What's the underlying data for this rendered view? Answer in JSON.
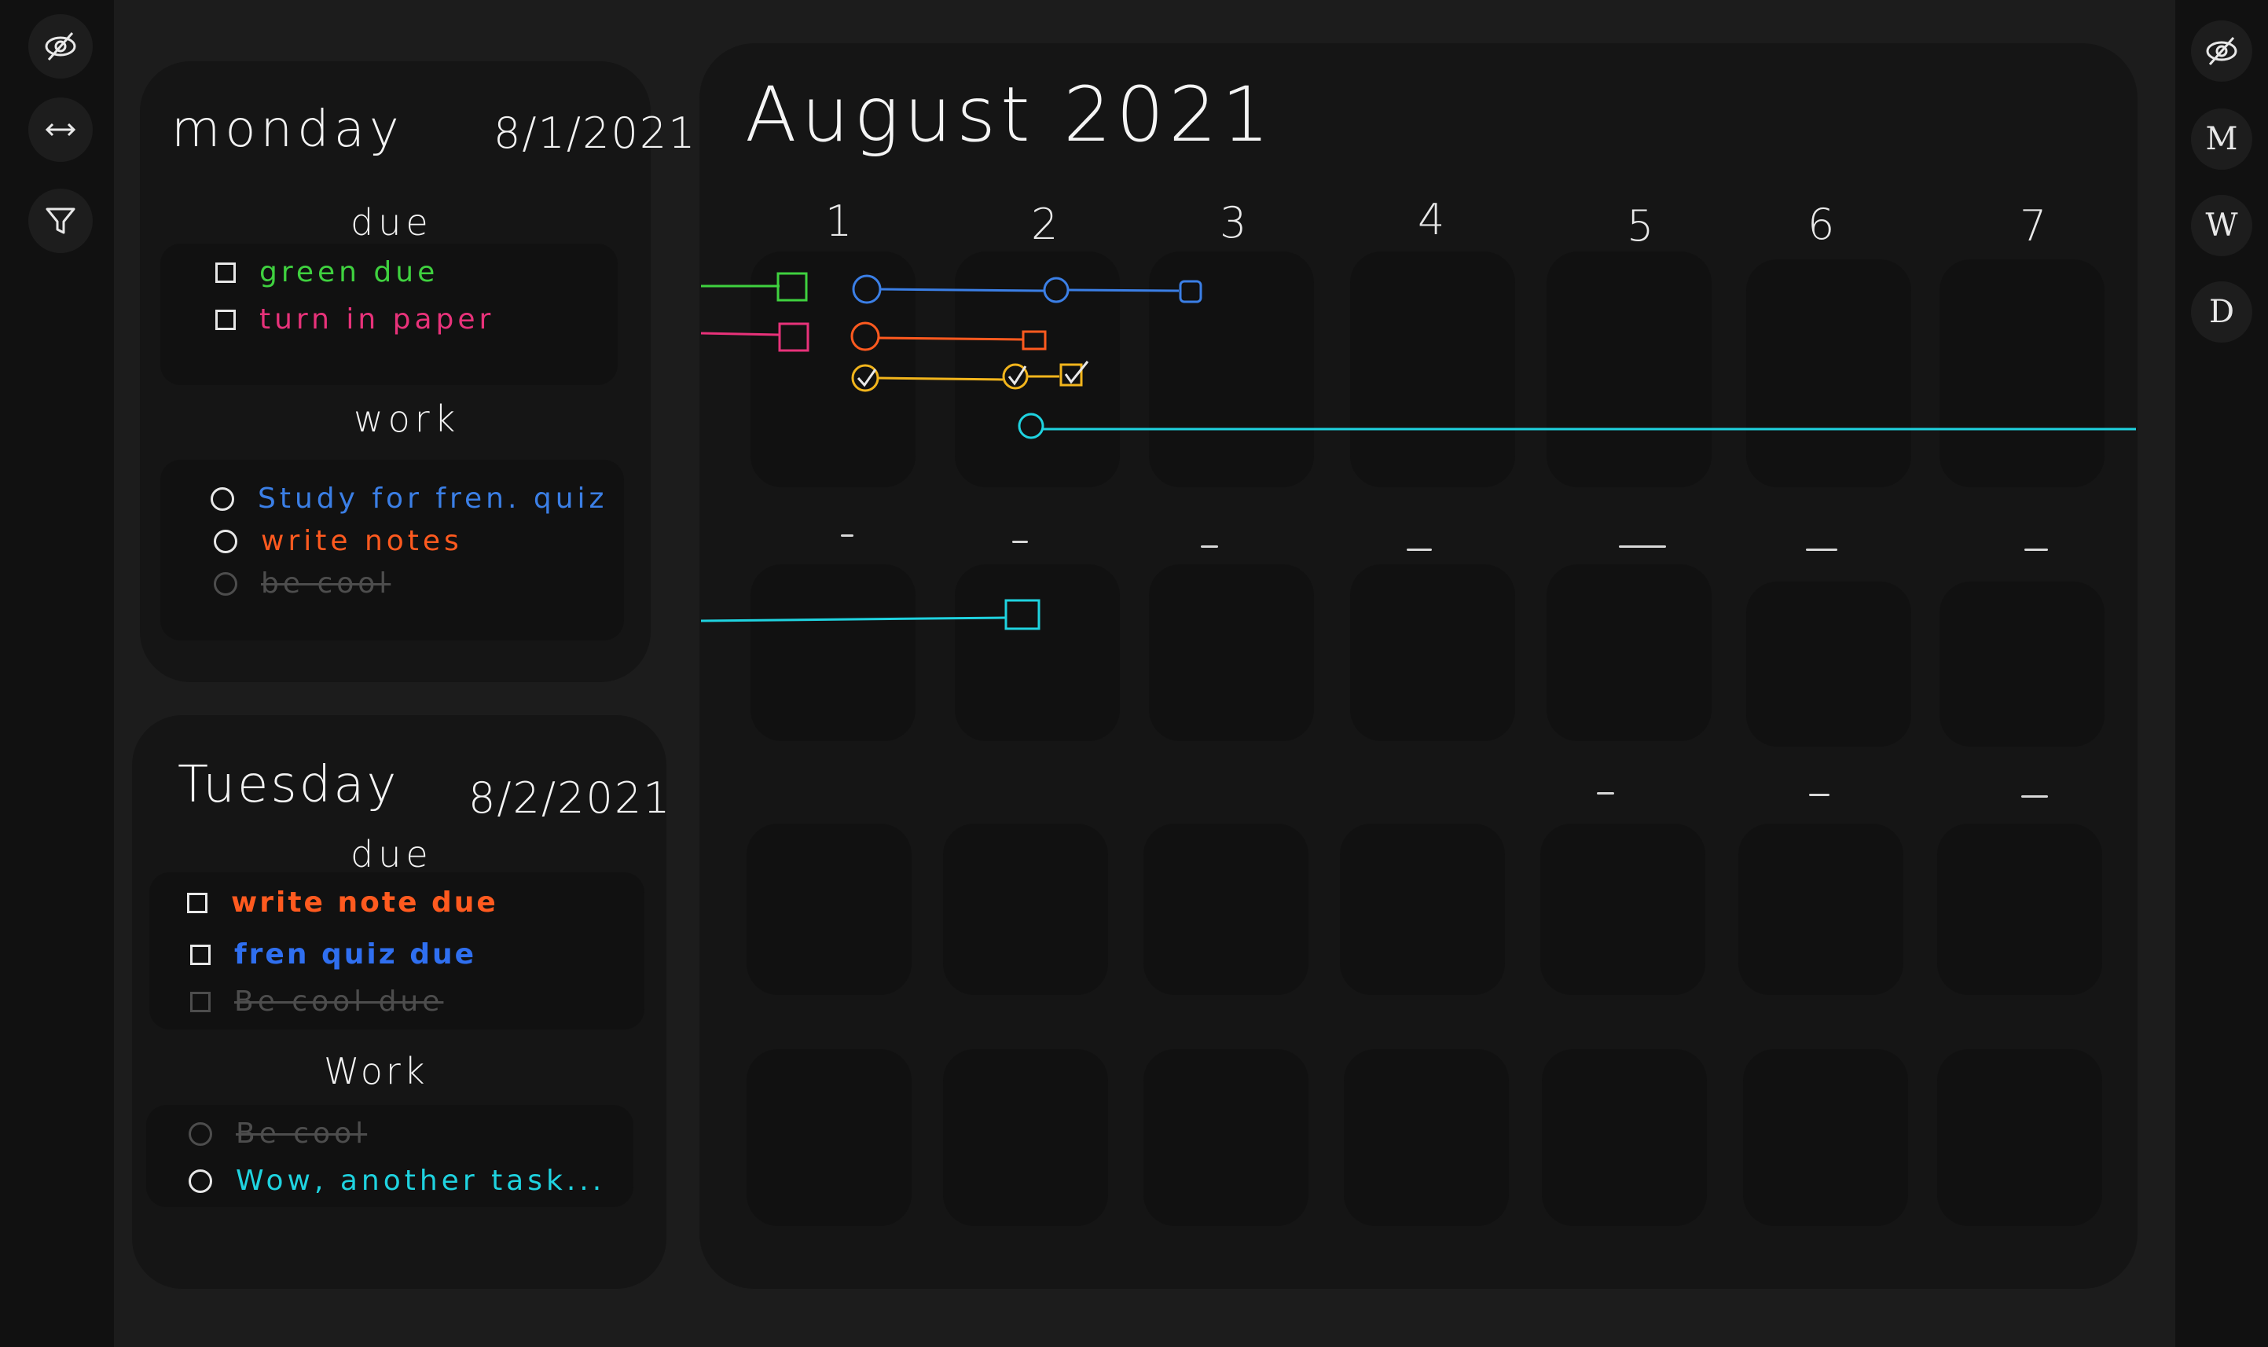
{
  "left_rail": {
    "buttons": [
      {
        "icon": "eye-off-icon"
      },
      {
        "icon": "swap-horizontal-icon"
      },
      {
        "icon": "filter-icon"
      }
    ]
  },
  "right_rail": {
    "buttons": [
      {
        "icon": "eye-off-icon"
      },
      {
        "label": "M"
      },
      {
        "label": "W"
      },
      {
        "label": "D"
      }
    ]
  },
  "monday": {
    "name": "monday",
    "date": "8/1/2021",
    "due_title": "due",
    "due": [
      {
        "text": "green due",
        "color": "#3fd13f",
        "done": false
      },
      {
        "text": "turn in paper",
        "color": "#e8327a",
        "done": false
      }
    ],
    "work_title": "work",
    "work": [
      {
        "text": "Study for fren. quiz",
        "color": "#3b7fe6",
        "done": false
      },
      {
        "text": "write notes",
        "color": "#ff5a1f",
        "done": false
      },
      {
        "text": "be cool",
        "color": "#4d4d4d",
        "done": true
      }
    ]
  },
  "tuesday": {
    "name": "Tuesday",
    "date": "8/2/2021",
    "due_title": "due",
    "due": [
      {
        "text": "write note due",
        "color": "#ff5a1f",
        "done": false
      },
      {
        "text": "fren quiz due",
        "color": "#2f6ff0",
        "done": false
      },
      {
        "text": "Be cool due",
        "color": "#4d4d4d",
        "done": true
      }
    ],
    "work_title": "Work",
    "work": [
      {
        "text": "Be cool",
        "color": "#4d4d4d",
        "done": true
      },
      {
        "text": "Wow, another task...",
        "color": "#1fd3e0",
        "done": false
      }
    ]
  },
  "calendar": {
    "title": "August 2021",
    "day_numbers": [
      "1",
      "2",
      "3",
      "4",
      "5",
      "6",
      "7"
    ],
    "colors": {
      "green": "#3fd13f",
      "pink": "#e8327a",
      "blue": "#3b7fe6",
      "orange": "#ff5a1f",
      "yellow": "#f2b51c",
      "cyan": "#1fd3e0"
    }
  }
}
